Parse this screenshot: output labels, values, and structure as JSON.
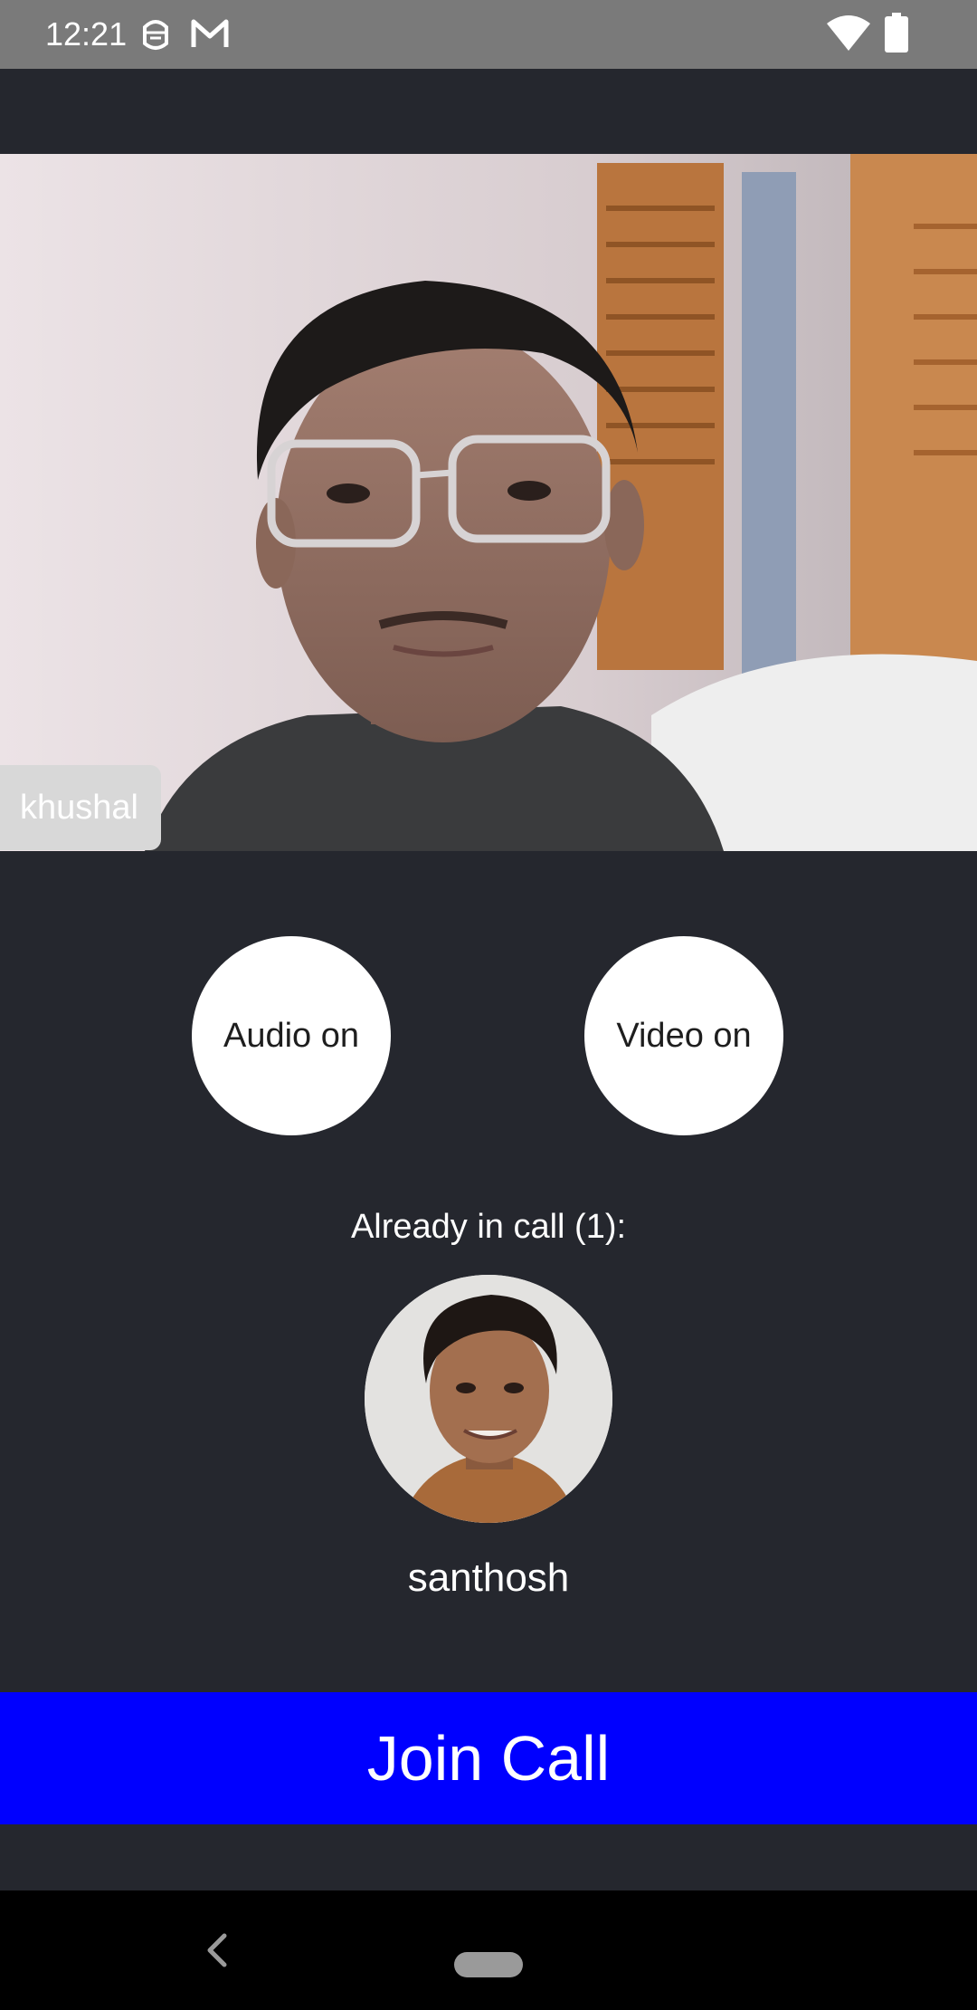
{
  "status_bar": {
    "time": "12:21",
    "icons": [
      "notification-app-icon",
      "gmail-icon",
      "wifi-icon",
      "battery-icon"
    ]
  },
  "preview": {
    "name_tag": "khushal"
  },
  "controls": {
    "audio_label": "Audio on",
    "video_label": "Video on"
  },
  "participants": {
    "heading": "Already in call (1):",
    "list": [
      {
        "name": "santhosh"
      }
    ]
  },
  "join_button": {
    "label": "Join Call"
  },
  "colors": {
    "background": "#25272e",
    "status_bar": "#7a7a7a",
    "join_button": "#0000ff",
    "toggle_button": "#ffffff",
    "nav_bar": "#000000"
  }
}
